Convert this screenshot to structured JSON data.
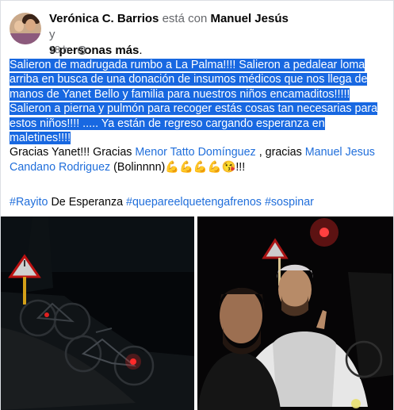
{
  "post": {
    "author": "Verónica C. Barrios",
    "with_text": "está con",
    "tagged": "Manuel Jesús",
    "connector": "y",
    "others": "9 personas más",
    "period": ".",
    "time": "18 h",
    "privacy_icon": "globe-icon",
    "menu_icon": "more-options-icon",
    "selected_text": "Salieron de madrugada rumbo a La Palma!!!! Salieron a pedalear loma arriba en busca de una donación de insumos médicos que nos llega de manos de Yanet Bello y familia para nuestros niños encamaditos!!!!! Salieron a pierna y pulmón para recoger estás cosas tan necesarias para estos niños!!!! ..... Ya están de regreso cargando esperanza en maletines!!!!",
    "thanks_prefix": "Gracias Yanet!!! Gracias ",
    "mention1": "Menor Tatto Domínguez",
    "thanks_mid": " , gracias ",
    "mention2": "Manuel Jesus Candano Rodriguez",
    "thanks_suffix": " (Bolinnnn)",
    "emojis": "💪💪💪💪😘",
    "thanks_end": "!!!",
    "hashtag1": "#Rayito",
    "hashtag_plain": " De Esperanza ",
    "hashtag2": "#quepareelquetengafrenos",
    "hashtag3": "#sospinar",
    "photo1": {
      "description_icon": "bicycles-night-photo",
      "sign_color": "#d8d8d8"
    },
    "photo2": {
      "description_icon": "selfie-night-photo"
    }
  }
}
